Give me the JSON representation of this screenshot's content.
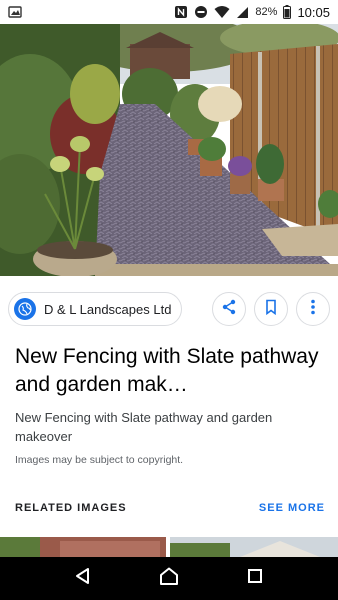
{
  "status_bar": {
    "time": "10:05",
    "battery_percent": "82%",
    "icons": [
      "image-icon",
      "nfc-icon",
      "do-not-disturb-icon",
      "wifi-icon",
      "signal-icon",
      "battery-icon"
    ]
  },
  "hero": {
    "alt": "",
    "icon": "garden-photo"
  },
  "source": {
    "name": "D & L Landscapes Ltd",
    "icon": "globe-icon"
  },
  "actions": {
    "icons": [
      "share-icon",
      "bookmark-icon",
      "more-vert-icon"
    ]
  },
  "result": {
    "title": "New Fencing with Slate pathway and garden mak…",
    "description": "New Fencing with Slate pathway and garden makeover",
    "copyright": "Images may be subject to copyright."
  },
  "related": {
    "label": "RELATED IMAGES",
    "see_more": "SEE MORE"
  },
  "nav": {
    "icons": [
      "back-icon",
      "home-icon",
      "recents-icon"
    ]
  },
  "colors": {
    "accent": "#1a73e8",
    "text_primary": "#000000",
    "text_secondary": "#5f6368",
    "nav_bg": "#000000"
  }
}
